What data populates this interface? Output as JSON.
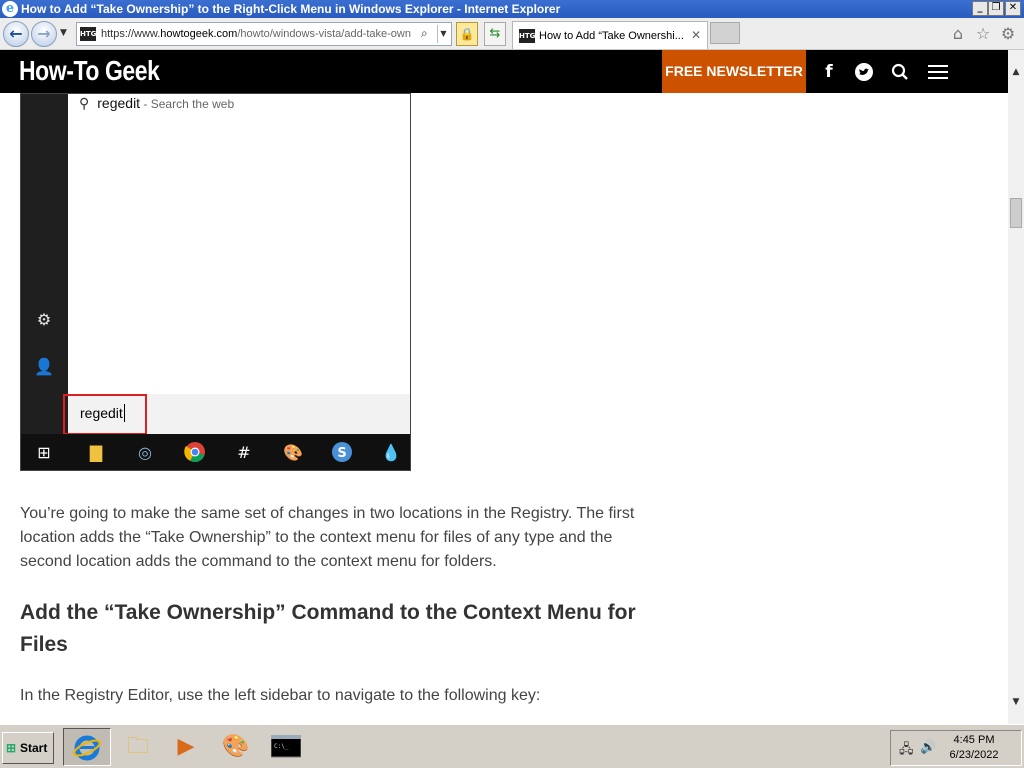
{
  "window": {
    "title": "How to Add “Take Ownership” to the Right-Click Menu in Windows Explorer - Internet Explorer",
    "minimize": "_",
    "restore": "❐",
    "close": "✕"
  },
  "browser": {
    "back": "←",
    "forward": "→",
    "address_favicon": "HTG",
    "url_scheme": "https://www.",
    "url_host": "howtogeek.com",
    "url_path": "/howto/windows-vista/add-take-own",
    "tab_label": "How to Add “Take Ownershi...",
    "tab_close": "✕",
    "icons": [
      "home-icon",
      "favorites-star-icon",
      "settings-gear-icon"
    ]
  },
  "site": {
    "logo": "How-To Geek",
    "newsletter": "FREE NEWSLETTER",
    "header_icons": [
      "facebook-icon",
      "twitter-icon",
      "search-icon",
      "menu-icon"
    ]
  },
  "screenshot": {
    "result_query": "regedit",
    "result_suffix": " - Search the web",
    "search_text": "regedit"
  },
  "article": {
    "p1": "You’re going to make the same set of changes in two locations in the Registry. The first location adds the “Take Ownership” to the context menu for files of any type and the second location adds the command to the context menu for folders.",
    "heading": "Add the “Take Ownership” Command to the Context Menu for Files",
    "p2": "In the Registry Editor, use the left sidebar to navigate to the following key:"
  },
  "taskbar": {
    "start": "Start",
    "apps": [
      "internet-explorer",
      "file-explorer",
      "media-player",
      "paint",
      "command-prompt"
    ],
    "time": "4:45 PM",
    "date": "6/23/2022"
  }
}
